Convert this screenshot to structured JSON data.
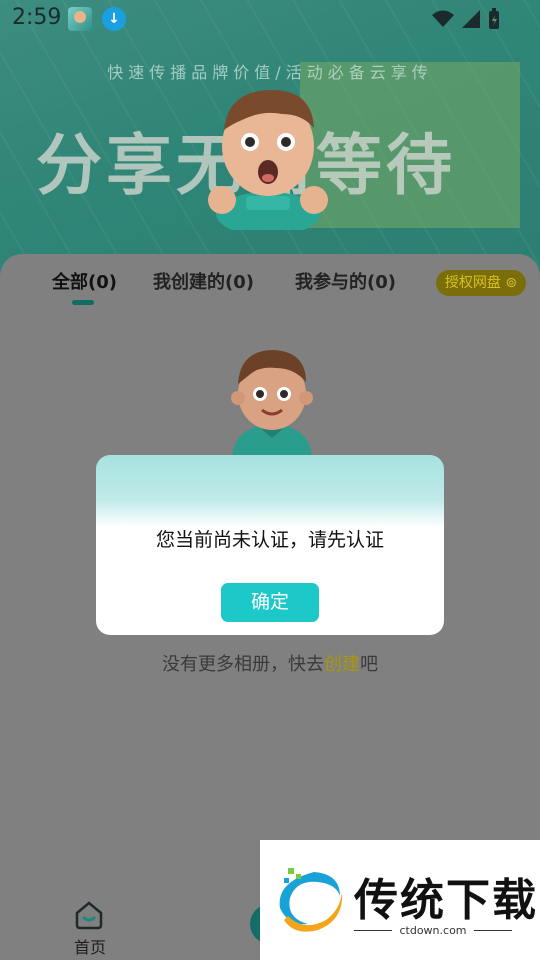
{
  "status_bar": {
    "time": "2:59"
  },
  "banner": {
    "slogan": "快速传播品牌价值/活动必备云享传",
    "title": "分享无需等待"
  },
  "tabs": [
    {
      "label": "全部(0)",
      "active": true
    },
    {
      "label": "我创建的(0)",
      "active": false
    },
    {
      "label": "我参与的(0)",
      "active": false
    }
  ],
  "auth_badge": {
    "label": "授权网盘"
  },
  "empty_state": {
    "text_prefix": "没有更多相册，快去",
    "link": "创建",
    "text_suffix": "吧"
  },
  "dialog": {
    "message": "您当前尚未认证，请先认证",
    "confirm_label": "确定"
  },
  "bottom_nav": {
    "home_label": "首页"
  },
  "watermark": {
    "title": "传统下载",
    "url": "ctdown.com"
  },
  "colors": {
    "accent": "#1dc8c8",
    "banner": "#2f8576",
    "link": "#a89510",
    "overlay": "#808080"
  }
}
